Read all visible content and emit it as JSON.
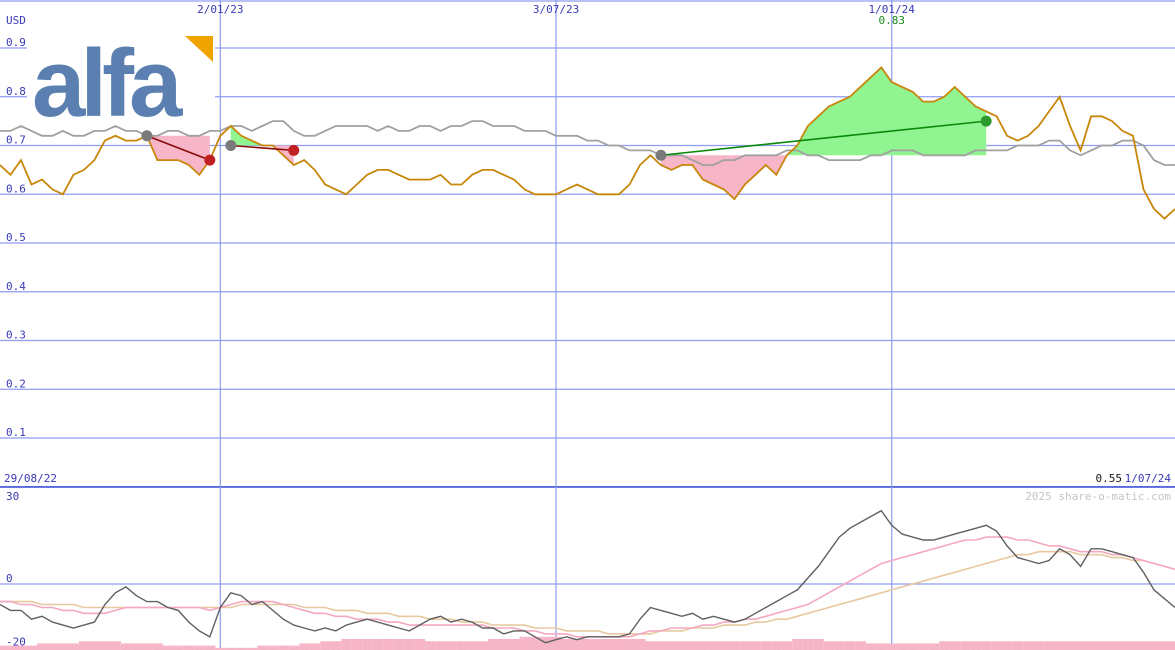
{
  "logo": {
    "text": "alfa",
    "text_color": "#5a7fb0",
    "accent_color": "#f0a400"
  },
  "watermark": "2025 share-o-matic.com",
  "colors": {
    "price": "#c8860a",
    "benchmark": "#a0a0a0",
    "grid": "#8f9cf0",
    "axis_text": "#3a3ab8",
    "gain_fill": "#90f590",
    "loss_fill": "#f6b6c8",
    "gain_line": "#0a8a0a",
    "loss_line": "#8a0a0a",
    "marker_gain": "#2e9a2e",
    "marker_loss": "#c02020",
    "marker_start": "#7a7a7a",
    "oscillator": "#606060",
    "osc_ma_fast": "#f4a8c0",
    "osc_ma_slow": "#e8c8a0",
    "volume": "#f6b6c8",
    "high_label": "#1a8a1a",
    "low_label": "#1a1a1a"
  },
  "chart_data": [
    {
      "type": "line",
      "currency_label": "USD",
      "y_ticks": [
        "0.9",
        "0.8",
        "0.7",
        "0.6",
        "0.5",
        "0.4",
        "0.3",
        "0.2",
        "0.1"
      ],
      "y_tick_values": [
        0.9,
        0.8,
        0.7,
        0.6,
        0.5,
        0.4,
        0.3,
        0.2,
        0.1
      ],
      "ylim": [
        0.0,
        0.9
      ],
      "x_top_labels": [
        "2/01/23",
        "3/07/23",
        "1/01/24"
      ],
      "x_top_label_index": [
        21,
        53,
        85
      ],
      "start_date_label": "29/08/22",
      "end_date_label": "1/07/24",
      "high_value_label": "0.83",
      "high_index": 85,
      "last_value_label": "0.55",
      "series": [
        {
          "name": "",
          "role": "price",
          "values": [
            0.66,
            0.64,
            0.67,
            0.62,
            0.63,
            0.61,
            0.6,
            0.64,
            0.65,
            0.67,
            0.71,
            0.72,
            0.71,
            0.71,
            0.72,
            0.67,
            0.67,
            0.67,
            0.66,
            0.64,
            0.67,
            0.72,
            0.74,
            0.72,
            0.71,
            0.7,
            0.7,
            0.68,
            0.66,
            0.67,
            0.65,
            0.62,
            0.61,
            0.6,
            0.62,
            0.64,
            0.65,
            0.65,
            0.64,
            0.63,
            0.63,
            0.63,
            0.64,
            0.62,
            0.62,
            0.64,
            0.65,
            0.65,
            0.64,
            0.63,
            0.61,
            0.6,
            0.6,
            0.6,
            0.61,
            0.62,
            0.61,
            0.6,
            0.6,
            0.6,
            0.62,
            0.66,
            0.68,
            0.66,
            0.65,
            0.66,
            0.66,
            0.63,
            0.62,
            0.61,
            0.59,
            0.62,
            0.64,
            0.66,
            0.64,
            0.68,
            0.7,
            0.74,
            0.76,
            0.78,
            0.79,
            0.8,
            0.82,
            0.84,
            0.86,
            0.83,
            0.82,
            0.81,
            0.79,
            0.79,
            0.8,
            0.82,
            0.8,
            0.78,
            0.77,
            0.76,
            0.72,
            0.71,
            0.72,
            0.74,
            0.77,
            0.8,
            0.74,
            0.69,
            0.76,
            0.76,
            0.75,
            0.73,
            0.72,
            0.61,
            0.57,
            0.55,
            0.57
          ]
        },
        {
          "name": "",
          "role": "benchmark",
          "values": [
            0.73,
            0.73,
            0.74,
            0.73,
            0.72,
            0.72,
            0.73,
            0.72,
            0.72,
            0.73,
            0.73,
            0.74,
            0.73,
            0.73,
            0.72,
            0.72,
            0.73,
            0.73,
            0.72,
            0.72,
            0.73,
            0.73,
            0.74,
            0.74,
            0.73,
            0.74,
            0.75,
            0.75,
            0.73,
            0.72,
            0.72,
            0.73,
            0.74,
            0.74,
            0.74,
            0.74,
            0.73,
            0.74,
            0.73,
            0.73,
            0.74,
            0.74,
            0.73,
            0.74,
            0.74,
            0.75,
            0.75,
            0.74,
            0.74,
            0.74,
            0.73,
            0.73,
            0.73,
            0.72,
            0.72,
            0.72,
            0.71,
            0.71,
            0.7,
            0.7,
            0.69,
            0.69,
            0.69,
            0.68,
            0.68,
            0.68,
            0.67,
            0.66,
            0.66,
            0.67,
            0.67,
            0.68,
            0.68,
            0.68,
            0.68,
            0.69,
            0.69,
            0.68,
            0.68,
            0.67,
            0.67,
            0.67,
            0.67,
            0.68,
            0.68,
            0.69,
            0.69,
            0.69,
            0.68,
            0.68,
            0.68,
            0.68,
            0.68,
            0.69,
            0.69,
            0.69,
            0.69,
            0.7,
            0.7,
            0.7,
            0.71,
            0.71,
            0.69,
            0.68,
            0.69,
            0.7,
            0.7,
            0.71,
            0.71,
            0.7,
            0.67,
            0.66,
            0.66
          ]
        }
      ],
      "trades": [
        {
          "start_index": 14,
          "end_index": 20,
          "start_value": 0.72,
          "end_value": 0.67,
          "result": "loss"
        },
        {
          "start_index": 22,
          "end_index": 28,
          "start_value": 0.7,
          "end_value": 0.69,
          "result": "loss"
        },
        {
          "start_index": 63,
          "end_index": 94,
          "start_value": 0.68,
          "end_value": 0.75,
          "result": "gain"
        }
      ]
    },
    {
      "type": "line",
      "y_ticks": [
        "30",
        "0",
        "-20"
      ],
      "y_tick_values": [
        30,
        0,
        -20
      ],
      "ylim": [
        -20,
        30
      ],
      "series": [
        {
          "name": "",
          "role": "oscillator",
          "values": [
            -7,
            -9,
            -9,
            -12,
            -11,
            -13,
            -14,
            -15,
            -14,
            -13,
            -7,
            -3,
            -1,
            -4,
            -6,
            -6,
            -8,
            -9,
            -13,
            -16,
            -18,
            -8,
            -3,
            -4,
            -7,
            -6,
            -9,
            -12,
            -14,
            -15,
            -16,
            -15,
            -16,
            -14,
            -13,
            -12,
            -13,
            -14,
            -15,
            -16,
            -14,
            -12,
            -11,
            -13,
            -12,
            -13,
            -15,
            -15,
            -17,
            -16,
            -16,
            -18,
            -20,
            -19,
            -18,
            -19,
            -18,
            -18,
            -18,
            -18,
            -17,
            -12,
            -8,
            -9,
            -10,
            -11,
            -10,
            -12,
            -11,
            -12,
            -13,
            -12,
            -10,
            -8,
            -6,
            -4,
            -2,
            2,
            6,
            11,
            16,
            19,
            21,
            23,
            25,
            20,
            17,
            16,
            15,
            15,
            16,
            17,
            18,
            19,
            20,
            18,
            13,
            9,
            8,
            7,
            8,
            12,
            10,
            6,
            12,
            12,
            11,
            10,
            9,
            4,
            -2,
            -5,
            -8
          ]
        },
        {
          "name": "",
          "role": "oscillator-average-fast",
          "values": [
            -6,
            -6,
            -7,
            -7,
            -8,
            -8,
            -9,
            -9,
            -10,
            -10,
            -10,
            -9,
            -8,
            -8,
            -8,
            -8,
            -8,
            -8,
            -8,
            -8,
            -9,
            -8,
            -7,
            -6,
            -6,
            -6,
            -6,
            -7,
            -8,
            -9,
            -10,
            -10,
            -11,
            -11,
            -12,
            -12,
            -12,
            -13,
            -13,
            -14,
            -14,
            -14,
            -14,
            -14,
            -14,
            -14,
            -14,
            -15,
            -15,
            -15,
            -16,
            -16,
            -17,
            -17,
            -17,
            -18,
            -18,
            -18,
            -18,
            -18,
            -18,
            -17,
            -16,
            -16,
            -15,
            -15,
            -15,
            -14,
            -14,
            -13,
            -13,
            -12,
            -12,
            -11,
            -10,
            -9,
            -8,
            -7,
            -5,
            -3,
            -1,
            1,
            3,
            5,
            7,
            8,
            9,
            10,
            11,
            12,
            13,
            14,
            15,
            15,
            16,
            16,
            16,
            15,
            15,
            14,
            13,
            13,
            12,
            11,
            11,
            11,
            10,
            10,
            9,
            8,
            7,
            6,
            5
          ]
        },
        {
          "name": "",
          "role": "oscillator-average-slow",
          "values": [
            -6,
            -6,
            -6,
            -6,
            -7,
            -7,
            -7,
            -7,
            -8,
            -8,
            -8,
            -8,
            -8,
            -8,
            -8,
            -8,
            -8,
            -8,
            -8,
            -8,
            -8,
            -8,
            -8,
            -7,
            -7,
            -7,
            -7,
            -7,
            -7,
            -8,
            -8,
            -8,
            -9,
            -9,
            -9,
            -10,
            -10,
            -10,
            -11,
            -11,
            -11,
            -12,
            -12,
            -12,
            -13,
            -13,
            -13,
            -14,
            -14,
            -14,
            -14,
            -15,
            -15,
            -15,
            -16,
            -16,
            -16,
            -16,
            -17,
            -17,
            -17,
            -17,
            -17,
            -16,
            -16,
            -16,
            -15,
            -15,
            -15,
            -14,
            -14,
            -14,
            -13,
            -13,
            -12,
            -12,
            -11,
            -10,
            -9,
            -8,
            -7,
            -6,
            -5,
            -4,
            -3,
            -2,
            -1,
            0,
            1,
            2,
            3,
            4,
            5,
            6,
            7,
            8,
            9,
            10,
            10,
            11,
            11,
            11,
            11,
            10,
            10,
            10,
            9,
            9,
            8,
            8,
            7,
            6,
            5
          ]
        }
      ],
      "volume": [
        2,
        2,
        2,
        2,
        3,
        3,
        3,
        3,
        4,
        4,
        4,
        4,
        3,
        3,
        3,
        3,
        2,
        2,
        2,
        2,
        2,
        1,
        1,
        1,
        1,
        2,
        2,
        2,
        2,
        3,
        3,
        4,
        4,
        5,
        5,
        5,
        5,
        5,
        5,
        5,
        5,
        4,
        4,
        4,
        4,
        4,
        4,
        5,
        5,
        5,
        6,
        6,
        6,
        6,
        5,
        5,
        5,
        5,
        5,
        5,
        5,
        5,
        4,
        4,
        4,
        4,
        4,
        4,
        4,
        4,
        4,
        4,
        4,
        4,
        4,
        4,
        5,
        5,
        5,
        4,
        4,
        4,
        4,
        3,
        3,
        3,
        3,
        3,
        3,
        3,
        4,
        4,
        4,
        4,
        4,
        4,
        4,
        4,
        4,
        4,
        4,
        4,
        4,
        4,
        4,
        4,
        4,
        4,
        4,
        4,
        4,
        4,
        4
      ]
    }
  ]
}
